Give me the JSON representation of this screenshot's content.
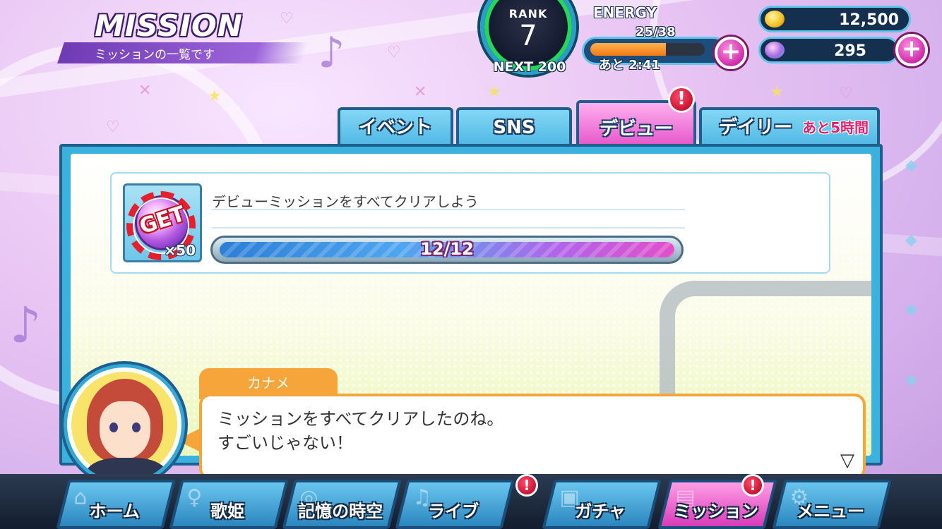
{
  "header": {
    "title": "MISSION",
    "subtitle": "ミッションの一覧です"
  },
  "rank": {
    "label": "RANK",
    "value": "7",
    "next": "NEXT 200"
  },
  "energy": {
    "label": "ENERGY",
    "count": "25/38",
    "fill_fraction": 0.66,
    "timer": "あと 2:41"
  },
  "currencies": {
    "coins": {
      "value": "12,500",
      "icon": "coin-icon"
    },
    "gems": {
      "value": "295",
      "icon": "planet-gem-icon"
    }
  },
  "tabs": [
    {
      "label": "イベント",
      "active": false
    },
    {
      "label": "SNS",
      "active": false
    },
    {
      "label": "デビュー",
      "active": true,
      "alert": "!"
    },
    {
      "label": "デイリー",
      "active": false,
      "extra": "あと5時間"
    }
  ],
  "mission": {
    "description": "デビューミッションをすべてクリアしよう",
    "reward_stamp": "GET",
    "reward_qty": "×50",
    "progress_text": "12/12",
    "progress_fraction": 1.0
  },
  "dialog": {
    "speaker": "カナメ",
    "lines": [
      "ミッションをすべてクリアしたのね。",
      "すごいじゃない！"
    ],
    "next_indicator": "▽"
  },
  "nav": {
    "items": [
      {
        "label": "ホーム",
        "icon": "home-icon"
      },
      {
        "label": "歌姫",
        "icon": "singer-icon"
      },
      {
        "label": "記憶の時空",
        "icon": "galaxy-icon"
      },
      {
        "label": "ライブ",
        "icon": "music-note-icon",
        "alert": "!"
      },
      {
        "label": "ガチャ",
        "icon": "gacha-icon"
      },
      {
        "label": "ミッション",
        "icon": "document-icon",
        "alert": "!",
        "active": true
      },
      {
        "label": "メニュー",
        "icon": "gear-icon"
      }
    ]
  },
  "colors": {
    "accent_pink": "#e24fc7",
    "accent_blue": "#3bb1dd",
    "dialog_orange": "#f5a53a"
  }
}
